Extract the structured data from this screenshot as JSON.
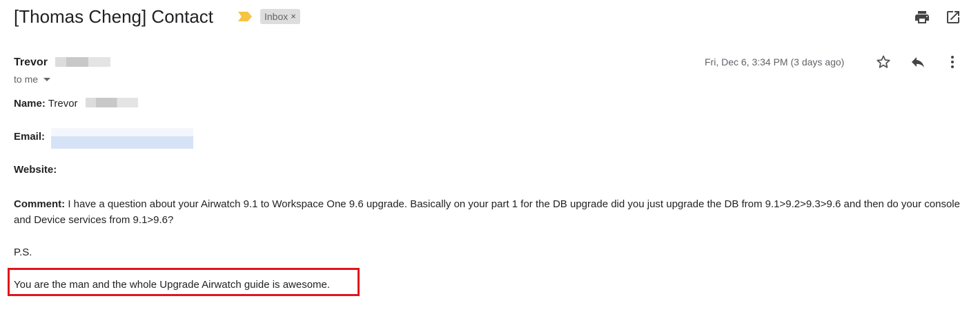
{
  "subject": "[Thomas Cheng] Contact",
  "label": {
    "name": "Inbox",
    "remove": "×"
  },
  "toolbar": {
    "print_icon": "print-icon",
    "popout_icon": "open-in-new-window-icon"
  },
  "message": {
    "sender_name": "Trevor",
    "to_line": "to me",
    "date": "Fri, Dec 6, 3:34 PM (3 days ago)",
    "icons": [
      "star-icon",
      "reply-icon",
      "more-vert-icon"
    ]
  },
  "body": {
    "name_label": "Name:",
    "name_value": "Trevor",
    "email_label": "Email:",
    "website_label": "Website:",
    "comment_label": "Comment:",
    "comment_text": "I have a question about your Airwatch 9.1 to Workspace One 9.6 upgrade. Basically on your part 1 for the DB upgrade did you just upgrade the DB from 9.1>9.2>9.3>9.6 and then do your console and Device services from 9.1>9.6?",
    "ps": "P.S.",
    "closing": "You are the man and the whole Upgrade Airwatch guide is awesome."
  },
  "colors": {
    "highlight_border": "#e0141a",
    "important_marker": "#f6c342",
    "label_bg": "#dddddd"
  }
}
